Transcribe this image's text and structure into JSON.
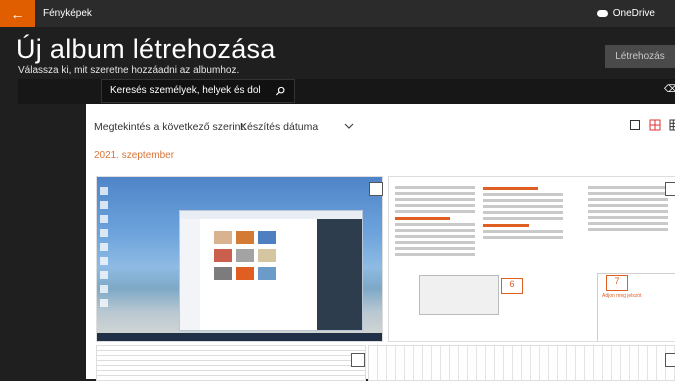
{
  "app": {
    "name": "Fényképek",
    "onedrive_label": "OneDrive",
    "back_icon": "arrow-left-icon"
  },
  "header": {
    "title": "Új album létrehozása",
    "subtitle": "Válassza ki, mit szeretne hozzáadni az albumhoz.",
    "create_button": "Létrehozás"
  },
  "search": {
    "placeholder": "Keresés személyek, helyek és dolgok k",
    "icon": "search-icon"
  },
  "toolbar": {
    "sort_label": "Megtekintés a következő szerint:",
    "sort_value": "Készítés dátuma",
    "view_icons": [
      "square-view-icon",
      "grid-view-icon",
      "large-grid-view-icon"
    ]
  },
  "group": {
    "date": "2021. szeptember"
  },
  "photos": [
    {
      "name": "desktop-screenshot"
    },
    {
      "name": "document-screenshot-1"
    },
    {
      "name": "document-screenshot-2"
    },
    {
      "name": "document-screenshot-3"
    }
  ],
  "doc_markers": {
    "six": "6",
    "seven": "7"
  },
  "doc_snippets": {
    "red_heading": "6. Microsoft Word",
    "red_subheading": "Többnyelvű kifejezések",
    "orange_note": "7",
    "tip": "Adjon meg jelszót"
  },
  "colors": {
    "accent": "#e05e00",
    "date": "#d87536",
    "dark_bg": "#1f1f1f"
  }
}
